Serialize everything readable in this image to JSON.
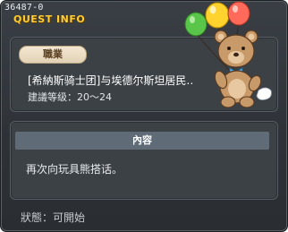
{
  "header": {
    "quest_id": "36487-0",
    "section_label": "QUEST INFO"
  },
  "job": {
    "tab_label": "職業",
    "title": "[希納斯骑士团]与埃德尔斯坦居民‥",
    "level_label": "建議等级：",
    "level_range": "20～24"
  },
  "content": {
    "header_label": "內容",
    "text": "再次向玩具熊搭话。"
  },
  "status": {
    "label": "狀態：",
    "value": "可開始"
  },
  "illustration": {
    "name": "teddy-bear-with-balloons",
    "balloon_colors": [
      "#ff6a5a",
      "#ffd22e",
      "#59c64a"
    ]
  }
}
